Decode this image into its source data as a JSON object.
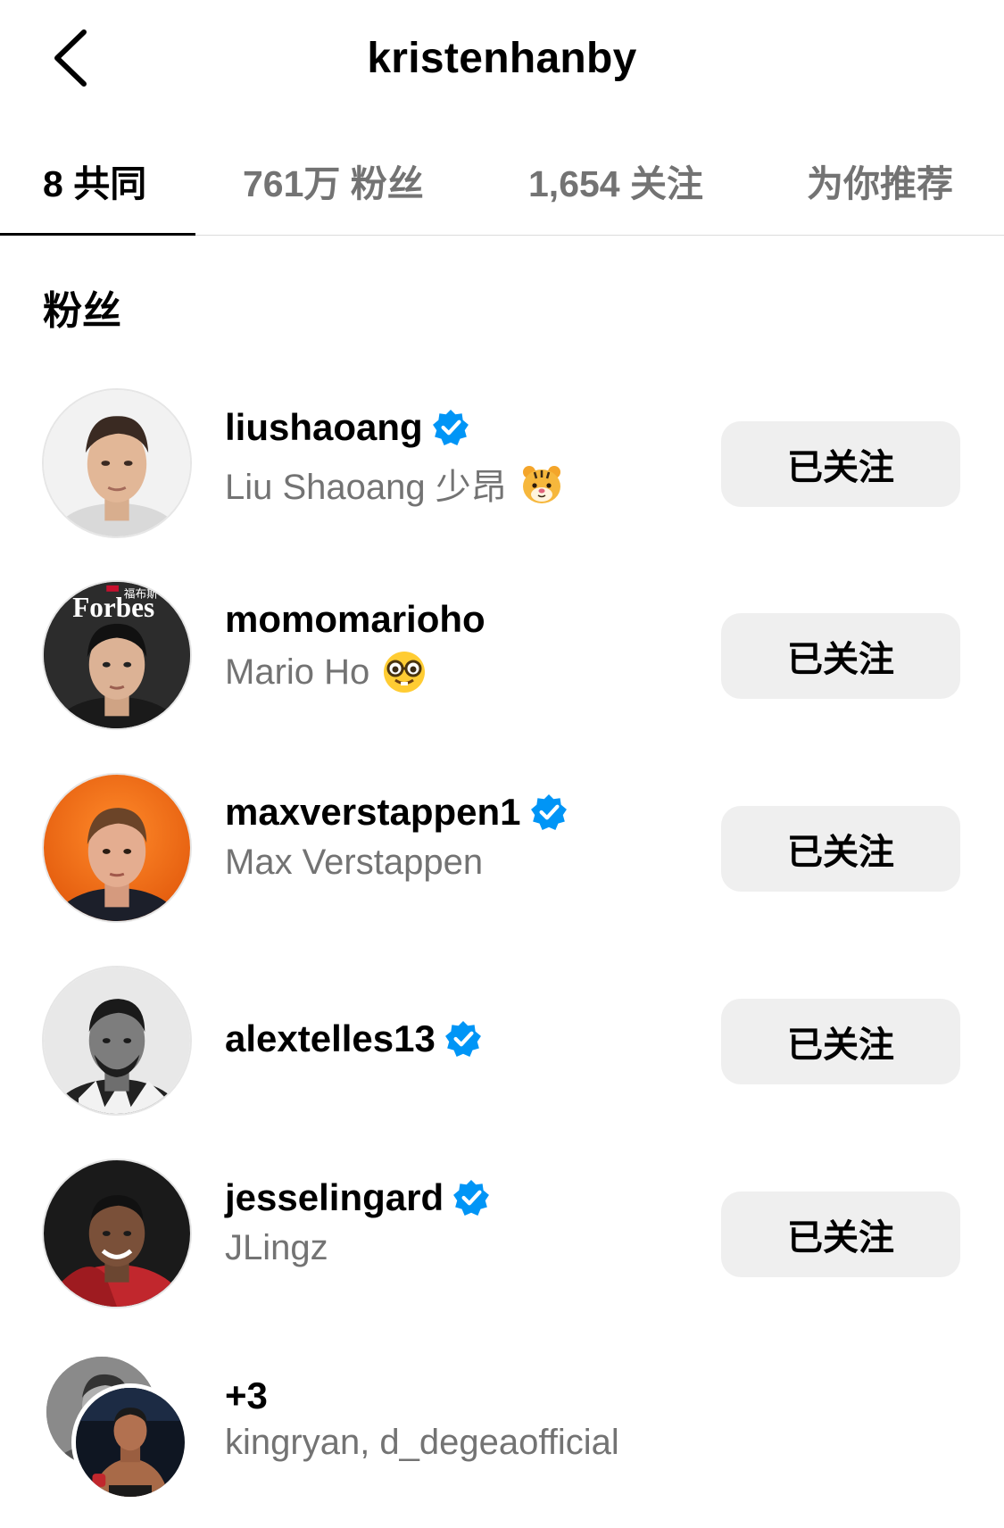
{
  "header": {
    "title": "kristenhanby"
  },
  "tabs": [
    {
      "label": "8 共同"
    },
    {
      "label": "761万 粉丝"
    },
    {
      "label": "1,654 关注"
    },
    {
      "label": "为你推荐"
    }
  ],
  "section": {
    "title": "粉丝"
  },
  "users": [
    {
      "username": "liushaoang",
      "fullname": "Liu Shaoang 少昂",
      "verified": true,
      "emoji": "tiger-face",
      "button": "已关注"
    },
    {
      "username": "momomarioho",
      "fullname": "Mario Ho",
      "verified": false,
      "emoji": "nerd-face",
      "button": "已关注"
    },
    {
      "username": "maxverstappen1",
      "fullname": "Max Verstappen",
      "verified": true,
      "button": "已关注"
    },
    {
      "username": "alextelles13",
      "fullname": "",
      "verified": true,
      "button": "已关注"
    },
    {
      "username": "jesselingard",
      "fullname": "JLingz",
      "verified": true,
      "button": "已关注"
    }
  ],
  "more": {
    "count": "+3",
    "names": "kingryan, d_degeaofficial"
  },
  "avatar_text": {
    "forbes": "Forbes",
    "forbes_cn": "福布斯"
  },
  "colors": {
    "verified": "#0095f6",
    "button_bg": "#efefef",
    "secondary_text": "#737373"
  }
}
